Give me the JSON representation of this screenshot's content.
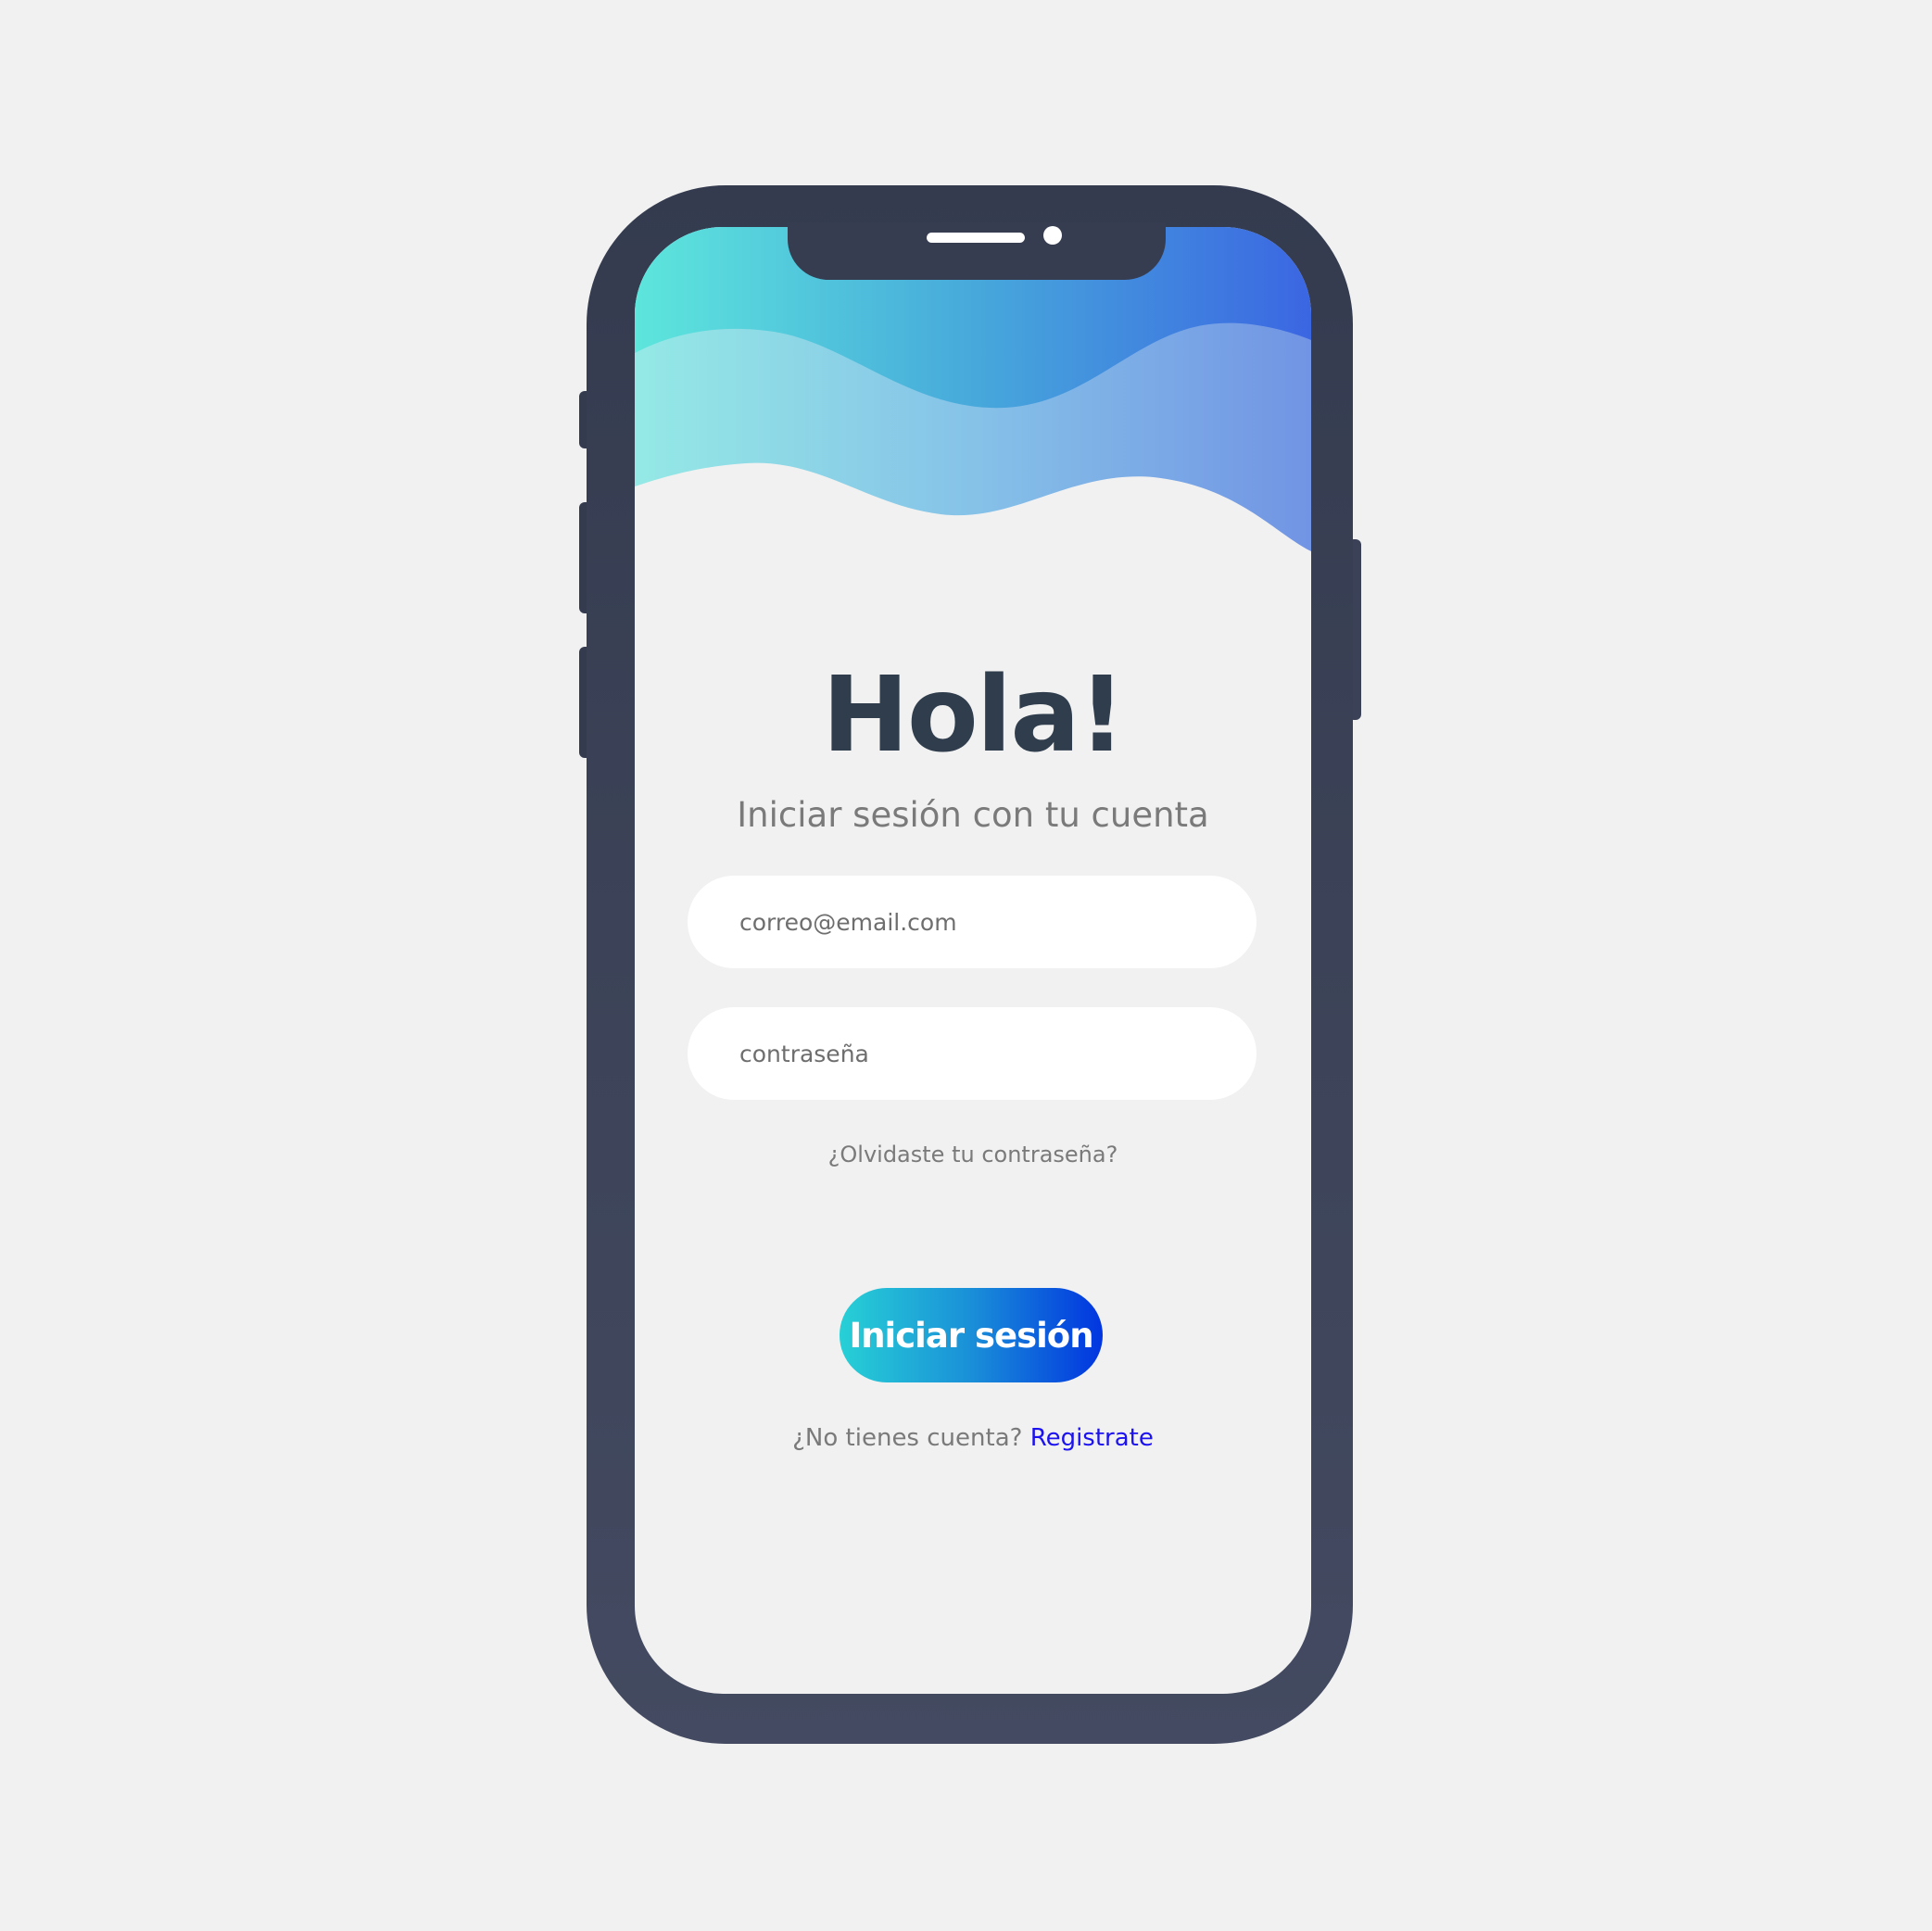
{
  "login": {
    "title": "Hola!",
    "subtitle": "Iniciar sesión con tu cuenta",
    "email_placeholder": "correo@email.com",
    "password_placeholder": "contraseña",
    "forgot_link": "¿Olvidaste tu contraseña?",
    "submit_label": "Iniciar sesión",
    "no_account_text": "¿No tienes cuenta?",
    "register_link": "Registrate"
  },
  "colors": {
    "background": "#f1f1f1",
    "phone_body": "#3a4155",
    "title_text": "#2f3d4d",
    "muted_text": "#7a7a7a",
    "link_blue": "#1c12f0",
    "gradient_start": "#27d0d6",
    "gradient_end": "#0135e0"
  }
}
